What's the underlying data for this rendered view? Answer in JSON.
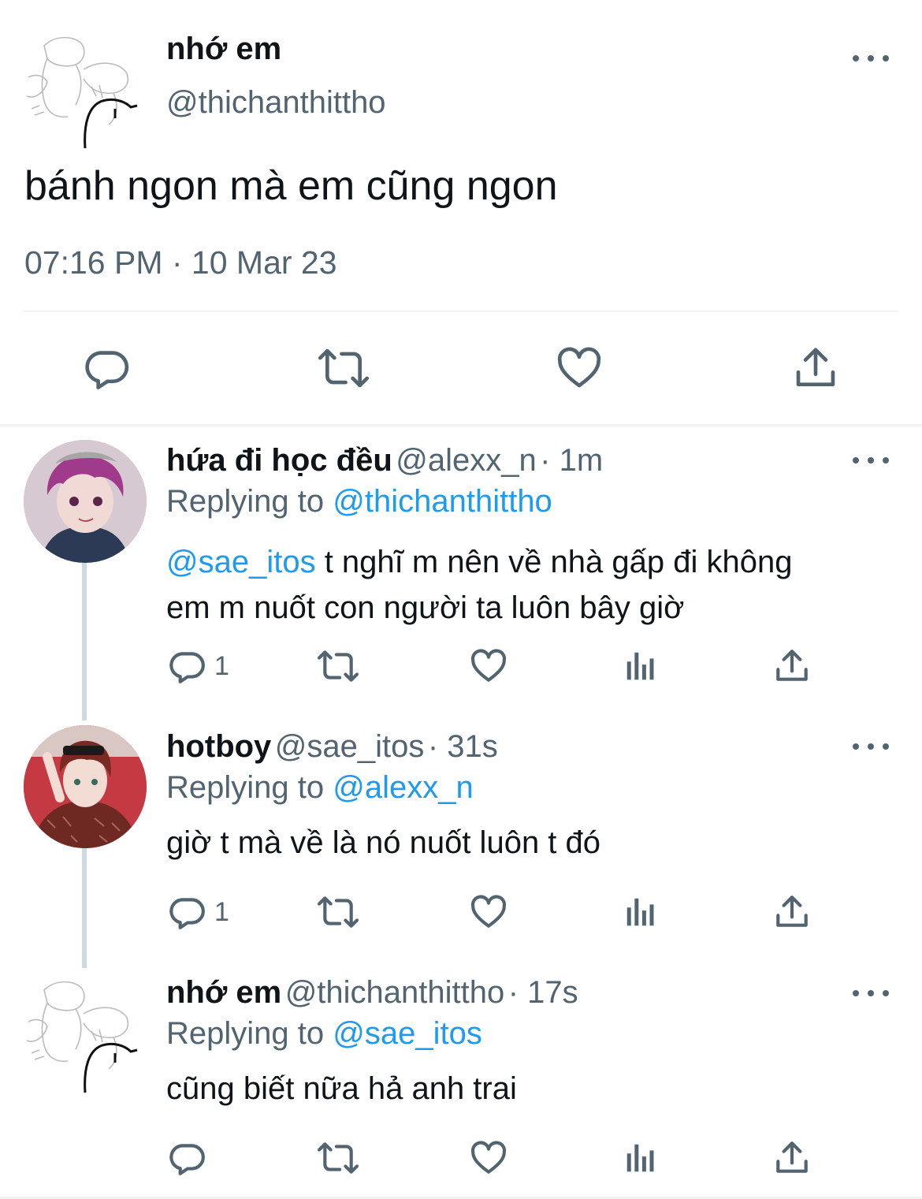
{
  "main_tweet": {
    "name": "nhớ em",
    "handle": "@thichanthittho",
    "text": "bánh ngon mà em cũng ngon",
    "timestamp": "07:16 PM · 10 Mar 23"
  },
  "replies": [
    {
      "name": "hứa đi học đều",
      "handle": "@alexx_n",
      "time": "· 1m",
      "replying_label": "Replying to",
      "replying_to": "@thichanthittho",
      "mention": "@sae_itos",
      "text_after_mention": " t nghĩ m nên về nhà gấp đi không",
      "text_line2": "em m nuốt con người ta luôn bây giờ",
      "reply_count": "1"
    },
    {
      "name": "hotboy",
      "handle": "@sae_itos",
      "time": "· 31s",
      "replying_label": "Replying to",
      "replying_to": "@alexx_n",
      "text": "giờ t mà về là nó nuốt luôn t đó",
      "reply_count": "1"
    },
    {
      "name": "nhớ em",
      "handle": "@thichanthittho",
      "time": "· 17s",
      "replying_label": "Replying to",
      "replying_to": "@sae_itos",
      "text": "cũng biết nữa hả anh trai"
    }
  ],
  "icons": [
    "reply-icon",
    "retweet-icon",
    "like-icon",
    "views-icon",
    "share-icon",
    "more-icon"
  ],
  "colors": {
    "link": "#1d9bf0",
    "secondary": "#536471",
    "text": "#0f1419"
  }
}
